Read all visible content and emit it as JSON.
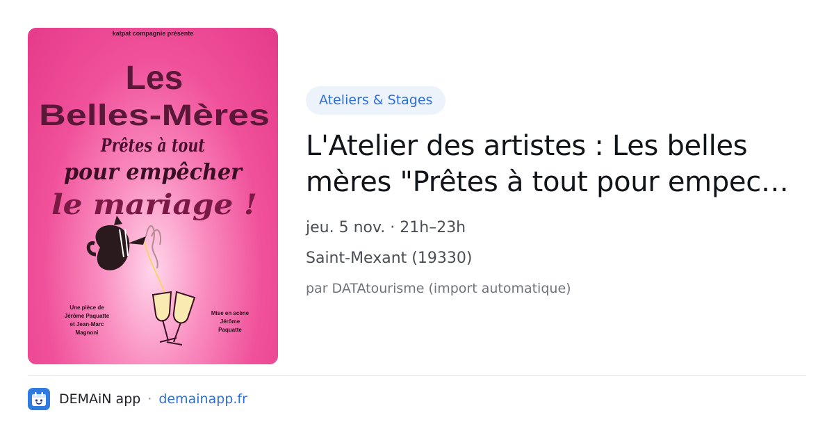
{
  "poster": {
    "presenter": "katpat compagnie présente",
    "title_line1": "Les",
    "title_line2": "Belles-Mères",
    "tagline_line1": "Prêtes à tout",
    "tagline_line2": "pour empêcher",
    "tagline_line3": "le mariage !",
    "credit_left": [
      "Une pièce de",
      "Jérôme Paquatte",
      "et Jean-Marc",
      "Magnoni"
    ],
    "credit_right": [
      "Mise en scène",
      "Jérôme",
      "Paquatte"
    ]
  },
  "event": {
    "category": "Ateliers & Stages",
    "title_line1": "L'Atelier des artistes : Les belles",
    "title_line2": "mères \"Prêtes à tout pour empec…",
    "datetime": "jeu. 5 nov. · 21h–23h",
    "location": "Saint-Mexant (19330)",
    "source": "par DATAtourisme (import automatique)"
  },
  "footer": {
    "app_icon": "calendar-face-icon",
    "app_name": "DEMAiN app",
    "separator": "·",
    "domain": "demainapp.fr"
  },
  "colors": {
    "accent": "#2f6fd3",
    "badge_bg": "#edf3fb",
    "poster_pink": "#f0509a",
    "poster_title": "#5a1838"
  }
}
